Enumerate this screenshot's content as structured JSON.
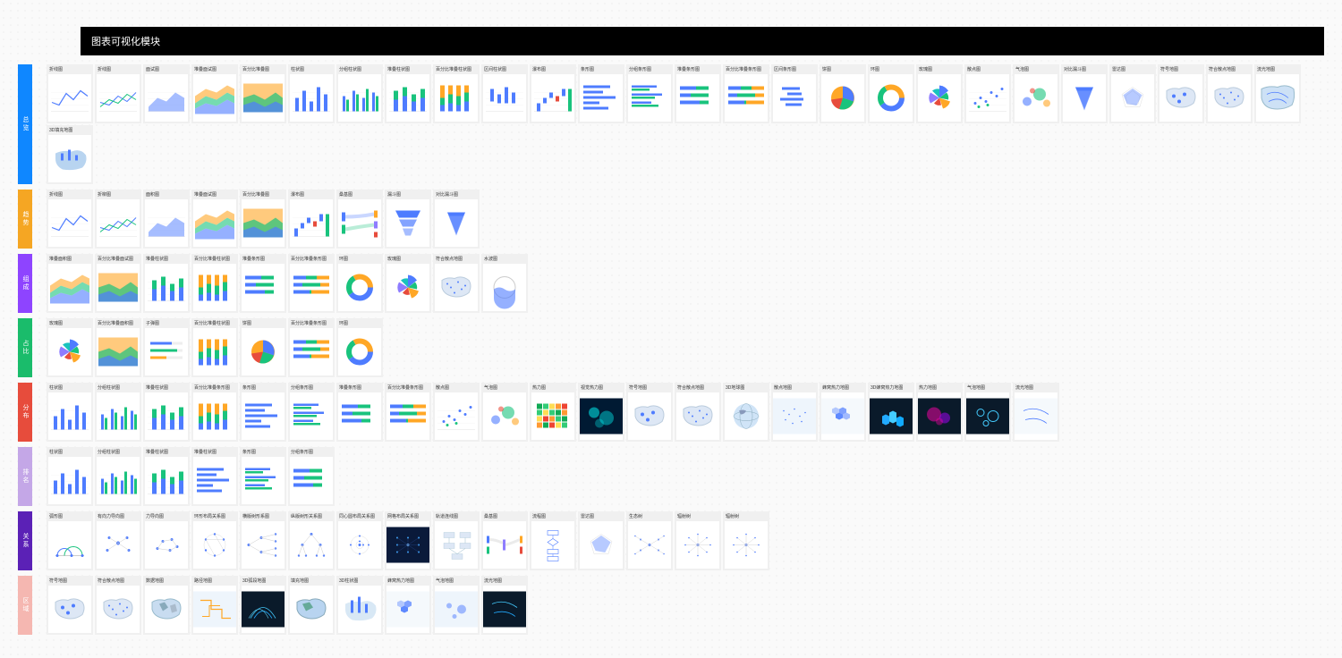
{
  "header": {
    "title": "图表可视化模块"
  },
  "categories": [
    {
      "name": "总览",
      "color": "tab-blue",
      "charts": [
        {
          "title": "折线图",
          "icon": "line"
        },
        {
          "title": "折线图",
          "icon": "lines"
        },
        {
          "title": "面试图",
          "icon": "area"
        },
        {
          "title": "堆叠面试图",
          "icon": "stackarea"
        },
        {
          "title": "百分比堆叠图",
          "icon": "pctstack"
        },
        {
          "title": "柱状图",
          "icon": "bar"
        },
        {
          "title": "分组柱状图",
          "icon": "groupbar"
        },
        {
          "title": "堆叠柱状图",
          "icon": "stackbar"
        },
        {
          "title": "百分比堆叠柱状图",
          "icon": "pctbar"
        },
        {
          "title": "区间柱状图",
          "icon": "rangebar"
        },
        {
          "title": "瀑布图",
          "icon": "waterfall"
        },
        {
          "title": "条形图",
          "icon": "hbar"
        },
        {
          "title": "分组条形图",
          "icon": "hgroupbar"
        },
        {
          "title": "堆叠条形图",
          "icon": "hstackbar"
        },
        {
          "title": "百分比堆叠条形图",
          "icon": "hpctbar"
        },
        {
          "title": "区间条形图",
          "icon": "hrangebar"
        },
        {
          "title": "饼图",
          "icon": "pie"
        },
        {
          "title": "环图",
          "icon": "donut"
        },
        {
          "title": "玫瑰图",
          "icon": "rose"
        },
        {
          "title": "散点图",
          "icon": "scatter"
        },
        {
          "title": "气泡图",
          "icon": "bubble"
        },
        {
          "title": "对比漏斗图",
          "icon": "pyramid"
        },
        {
          "title": "雷达图",
          "icon": "radar"
        },
        {
          "title": "符号地图",
          "icon": "symbolmap"
        },
        {
          "title": "符合散点地图",
          "icon": "scattermap"
        },
        {
          "title": "流光地图",
          "icon": "flowmap"
        },
        {
          "title": "3D填充地图",
          "icon": "3dfillmap"
        }
      ]
    },
    {
      "name": "趋势",
      "color": "tab-orange",
      "charts": [
        {
          "title": "折线图",
          "icon": "line"
        },
        {
          "title": "折柳图",
          "icon": "lines"
        },
        {
          "title": "面积图",
          "icon": "area"
        },
        {
          "title": "堆叠面试图",
          "icon": "stackarea"
        },
        {
          "title": "百分比堆叠图",
          "icon": "pctstack"
        },
        {
          "title": "瀑布图",
          "icon": "waterfall2"
        },
        {
          "title": "桑基图",
          "icon": "sankey"
        },
        {
          "title": "漏斗图",
          "icon": "funnel"
        },
        {
          "title": "对比漏斗图",
          "icon": "pyramid"
        }
      ]
    },
    {
      "name": "组成",
      "color": "tab-purple",
      "charts": [
        {
          "title": "堆叠面积图",
          "icon": "stackarea"
        },
        {
          "title": "百分比堆叠面试图",
          "icon": "pctstack"
        },
        {
          "title": "堆叠柱状图",
          "icon": "stackbar"
        },
        {
          "title": "百分比堆叠柱状图",
          "icon": "pctbar"
        },
        {
          "title": "堆叠条形图",
          "icon": "hstackbar"
        },
        {
          "title": "百分比堆叠条形图",
          "icon": "hpctbar"
        },
        {
          "title": "环图",
          "icon": "donut"
        },
        {
          "title": "玫瑰图",
          "icon": "rose"
        },
        {
          "title": "符合散点地图",
          "icon": "scattermap"
        },
        {
          "title": "水波图",
          "icon": "liquid"
        }
      ]
    },
    {
      "name": "占比",
      "color": "tab-green",
      "charts": [
        {
          "title": "玫瑰图",
          "icon": "rose"
        },
        {
          "title": "百分比堆叠面积图",
          "icon": "pctstack"
        },
        {
          "title": "子弹图",
          "icon": "bullet"
        },
        {
          "title": "百分比堆叠柱状图",
          "icon": "pctbar"
        },
        {
          "title": "饼图",
          "icon": "pie"
        },
        {
          "title": "百分比堆叠条形图",
          "icon": "hpctbar"
        },
        {
          "title": "环图",
          "icon": "donut"
        }
      ]
    },
    {
      "name": "分布",
      "color": "tab-red",
      "charts": [
        {
          "title": "柱状图",
          "icon": "bar"
        },
        {
          "title": "分组柱状图",
          "icon": "groupbar"
        },
        {
          "title": "堆叠柱状图",
          "icon": "stackbar"
        },
        {
          "title": "百分比堆叠条形图",
          "icon": "pctbar"
        },
        {
          "title": "条形图",
          "icon": "hbar"
        },
        {
          "title": "分组条形图",
          "icon": "hgroupbar"
        },
        {
          "title": "堆叠条形图",
          "icon": "hstackbar"
        },
        {
          "title": "百分比堆叠条形图",
          "icon": "hpctbar"
        },
        {
          "title": "散点图",
          "icon": "scatter"
        },
        {
          "title": "气泡图",
          "icon": "bubble"
        },
        {
          "title": "热力图",
          "icon": "heatmap"
        },
        {
          "title": "视觉热力图",
          "icon": "visheat"
        },
        {
          "title": "符号地图",
          "icon": "symbolmap"
        },
        {
          "title": "符合散点地图",
          "icon": "scattermap"
        },
        {
          "title": "3D地球图",
          "icon": "globe"
        },
        {
          "title": "散点地图",
          "icon": "dotmap"
        },
        {
          "title": "蜂窝热力地图",
          "icon": "hexmap"
        },
        {
          "title": "3D蜂窝热力地图",
          "icon": "3dhex"
        },
        {
          "title": "热力地图",
          "icon": "heatmapgeo"
        },
        {
          "title": "气泡地图",
          "icon": "bubblemap"
        },
        {
          "title": "流光地图",
          "icon": "flowmap2"
        }
      ]
    },
    {
      "name": "排名",
      "color": "tab-lavender",
      "charts": [
        {
          "title": "柱状图",
          "icon": "bar"
        },
        {
          "title": "分组柱状图",
          "icon": "groupbar"
        },
        {
          "title": "堆叠柱状图",
          "icon": "stackbar"
        },
        {
          "title": "堆叠柱状图",
          "icon": "hbar"
        },
        {
          "title": "条形图",
          "icon": "hgroupbar"
        },
        {
          "title": "分组条形图",
          "icon": "hstackbar"
        }
      ]
    },
    {
      "name": "关系",
      "color": "tab-violet",
      "charts": [
        {
          "title": "弧形图",
          "icon": "arc"
        },
        {
          "title": "有向力导向图",
          "icon": "force"
        },
        {
          "title": "力导向图",
          "icon": "force2"
        },
        {
          "title": "环形布局关系图",
          "icon": "circforce"
        },
        {
          "title": "横版树形系图",
          "icon": "tree"
        },
        {
          "title": "纵版树形关系图",
          "icon": "vtree"
        },
        {
          "title": "同心圆布局关系图",
          "icon": "concentric"
        },
        {
          "title": "网格布局关系图",
          "icon": "gridforce"
        },
        {
          "title": "轨道连线图",
          "icon": "orbit"
        },
        {
          "title": "桑基图",
          "icon": "sankey2"
        },
        {
          "title": "流程图",
          "icon": "flow"
        },
        {
          "title": "雷达图",
          "icon": "radar2"
        },
        {
          "title": "生态树",
          "icon": "ecotree"
        },
        {
          "title": "辐射树",
          "icon": "radialtree"
        },
        {
          "title": "辐射树",
          "icon": "radialtree"
        }
      ]
    },
    {
      "name": "区域",
      "color": "tab-pink",
      "charts": [
        {
          "title": "符号地图",
          "icon": "symbolmap"
        },
        {
          "title": "符合散点地图",
          "icon": "scattermap"
        },
        {
          "title": "数据地图",
          "icon": "datamap"
        },
        {
          "title": "路径地图",
          "icon": "pathmap"
        },
        {
          "title": "3D弧段地图",
          "icon": "3darc"
        },
        {
          "title": "填充地图",
          "icon": "fillmap"
        },
        {
          "title": "3D柱状图",
          "icon": "3dbar"
        },
        {
          "title": "蜂窝热力地图",
          "icon": "hexmap2"
        },
        {
          "title": "气泡地图",
          "icon": "bubblemap2"
        },
        {
          "title": "流光地图",
          "icon": "flowmap3"
        }
      ]
    }
  ]
}
